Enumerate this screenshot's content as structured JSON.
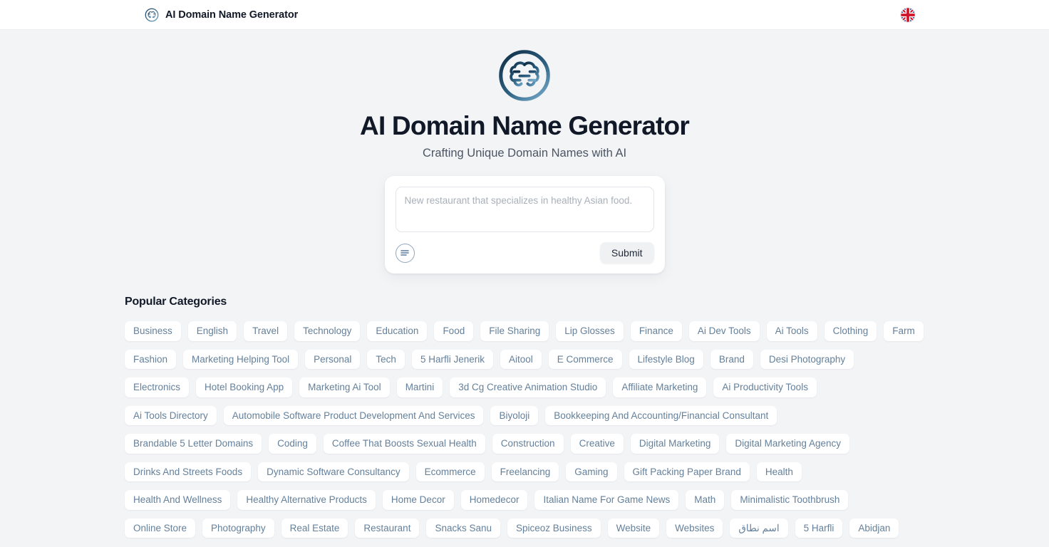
{
  "topbar": {
    "brand_title": "AI Domain Name Generator",
    "logo_icon": "brain-circle-icon",
    "language_icon": "uk-flag-icon"
  },
  "hero": {
    "logo_icon": "brain-circle-icon",
    "title": "AI Domain Name Generator",
    "subtitle": "Crafting Unique Domain Names with AI"
  },
  "prompt": {
    "placeholder": "New restaurant that specializes in healthy Asian food.",
    "value": "",
    "options_icon": "menu-lines-circle-icon",
    "submit_label": "Submit"
  },
  "categories": {
    "title": "Popular Categories",
    "rows": [
      [
        "Business",
        "English",
        "Travel",
        "Technology",
        "Education",
        "Food",
        "File Sharing",
        "Lip Glosses",
        "Finance",
        "Ai Dev Tools",
        "Ai Tools",
        "Clothing",
        "Farm"
      ],
      [
        "Fashion",
        "Marketing Helping Tool",
        "Personal",
        "Tech",
        "5 Harfli Jenerik",
        "Aitool",
        "E Commerce",
        "Lifestyle Blog",
        "Brand",
        "Desi Photography"
      ],
      [
        "Electronics",
        "Hotel Booking App",
        "Marketing Ai Tool",
        "Martini",
        "3d Cg Creative Animation Studio",
        "Affiliate Marketing",
        "Ai Productivity Tools"
      ],
      [
        "Ai Tools Directory",
        "Automobile Software Product Development And Services",
        "Biyoloji",
        "Bookkeeping And Accounting/Financial Consultant"
      ],
      [
        "Brandable 5 Letter Domains",
        "Coding",
        "Coffee That Boosts Sexual Health",
        "Construction",
        "Creative",
        "Digital Marketing",
        "Digital Marketing Agency"
      ],
      [
        "Drinks And Streets Foods",
        "Dynamic Software Consultancy",
        "Ecommerce",
        "Freelancing",
        "Gaming",
        "Gift Packing Paper Brand",
        "Health"
      ],
      [
        "Health And Wellness",
        "Healthy Alternative Products",
        "Home Decor",
        "Homedecor",
        "Italian Name For Game News",
        "Math",
        "Minimalistic Toothbrush"
      ],
      [
        "Online Store",
        "Photography",
        "Real Estate",
        "Restaurant",
        "Snacks Sanu",
        "Spiceoz Business",
        "Website",
        "Websites",
        "اسم نطاق",
        "5 Harfli",
        "Abidjan"
      ]
    ]
  },
  "colors": {
    "page_bg": "#f3f4f6",
    "card_bg": "#ffffff",
    "heading": "#111827",
    "subtitle": "#4b5563",
    "tag_text": "#64809b",
    "logo_dark": "#14324a",
    "logo_light": "#5b93b8",
    "submit_bg": "#f0f1f3"
  }
}
